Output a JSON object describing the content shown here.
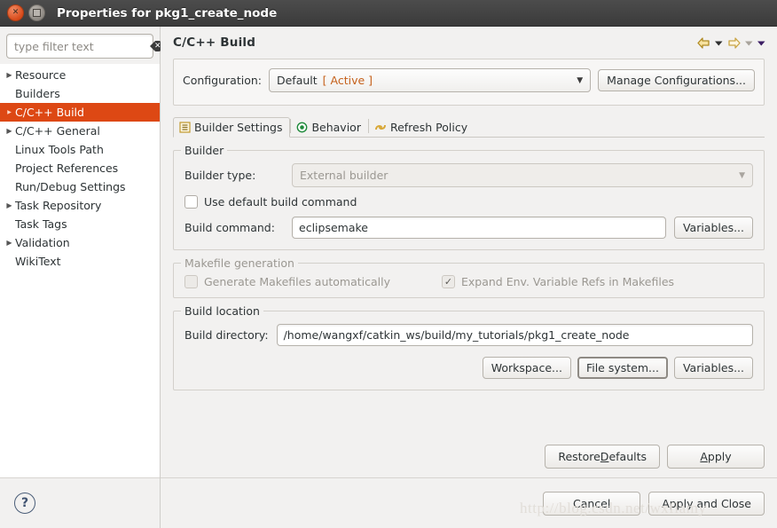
{
  "window": {
    "title": "Properties for pkg1_create_node",
    "close_glyph": "✕",
    "maximize_glyph": "□"
  },
  "sidebar": {
    "filter": {
      "value": "",
      "placeholder": "type filter text",
      "clear_glyph": "⌫"
    },
    "items": [
      {
        "label": "Resource",
        "expandable": true,
        "selected": false
      },
      {
        "label": "Builders",
        "expandable": false,
        "selected": false
      },
      {
        "label": "C/C++ Build",
        "expandable": true,
        "selected": true
      },
      {
        "label": "C/C++ General",
        "expandable": true,
        "selected": false
      },
      {
        "label": "Linux Tools Path",
        "expandable": false,
        "selected": false
      },
      {
        "label": "Project References",
        "expandable": false,
        "selected": false
      },
      {
        "label": "Run/Debug Settings",
        "expandable": false,
        "selected": false
      },
      {
        "label": "Task Repository",
        "expandable": true,
        "selected": false
      },
      {
        "label": "Task Tags",
        "expandable": false,
        "selected": false
      },
      {
        "label": "Validation",
        "expandable": true,
        "selected": false
      },
      {
        "label": "WikiText",
        "expandable": false,
        "selected": false
      }
    ],
    "help_glyph": "?"
  },
  "header": {
    "page_title": "C/C++ Build",
    "nav": {
      "back_glyph": "⬅",
      "back_menu_glyph": "▼",
      "forward_glyph": "➡",
      "forward_menu_glyph": "▼",
      "view_menu_glyph": "▼"
    }
  },
  "configuration": {
    "label": "Configuration:",
    "value_name": "Default",
    "value_state": "[ Active ]",
    "caret_glyph": "▼",
    "manage_button": "Manage Configurations..."
  },
  "tabs": [
    {
      "label": "Builder Settings",
      "icon": "list-icon",
      "active": true
    },
    {
      "label": "Behavior",
      "icon": "target-icon",
      "active": false
    },
    {
      "label": "Refresh Policy",
      "icon": "refresh-icon",
      "active": false
    }
  ],
  "builder_group": {
    "legend": "Builder",
    "builder_type_label": "Builder type:",
    "builder_type_value": "External builder",
    "builder_type_caret": "▼",
    "use_default_label": "Use default build command",
    "use_default_checked": false,
    "build_command_label": "Build command:",
    "build_command_value": "eclipsemake",
    "variables_button": "Variables..."
  },
  "makefile_group": {
    "legend": "Makefile generation",
    "generate_label": "Generate Makefiles automatically",
    "generate_checked": false,
    "expand_label": "Expand Env. Variable Refs in Makefiles",
    "expand_checked": true,
    "check_glyph": "✓"
  },
  "build_location_group": {
    "legend": "Build location",
    "directory_label": "Build directory:",
    "directory_value": "/home/wangxf/catkin_ws/build/my_tutorials/pkg1_create_node",
    "workspace_button": "Workspace...",
    "filesystem_button": "File system...",
    "variables_button": "Variables..."
  },
  "footer": {
    "restore_defaults_prefix": "Restore ",
    "restore_defaults_mnemonic": "D",
    "restore_defaults_suffix": "efaults",
    "apply_mnemonic": "A",
    "apply_suffix": "pply",
    "cancel": "Cancel",
    "apply_and_close": "Apply and Close"
  },
  "watermark": "http://blog.csdn.net/wxflamy",
  "colors": {
    "accent": "#dd4814",
    "titlebar": "#3f3f3f",
    "panel": "#f2f1f0",
    "active_value": "#c5601a"
  }
}
